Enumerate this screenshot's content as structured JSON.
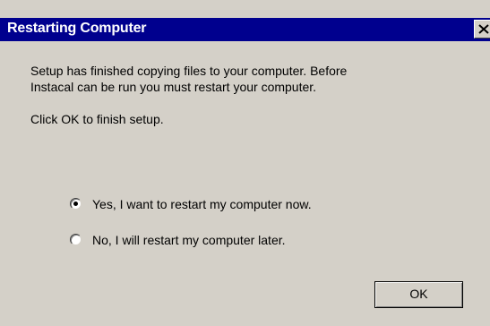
{
  "dialog": {
    "title": "Restarting Computer",
    "close_symbol": "×",
    "message_line1": "Setup has finished copying files to your computer.  Before",
    "message_line2": "Instacal can be run you must restart your computer.",
    "instruction": "Click OK to finish setup.",
    "options": [
      {
        "label": "Yes, I want to restart my computer now.",
        "selected": true
      },
      {
        "label": "No, I will restart my computer later.",
        "selected": false
      }
    ],
    "ok_label": "OK"
  },
  "colors": {
    "titlebar": "#00008e",
    "dialog_bg": "#d4d0c8",
    "title_text": "#ffffff"
  }
}
